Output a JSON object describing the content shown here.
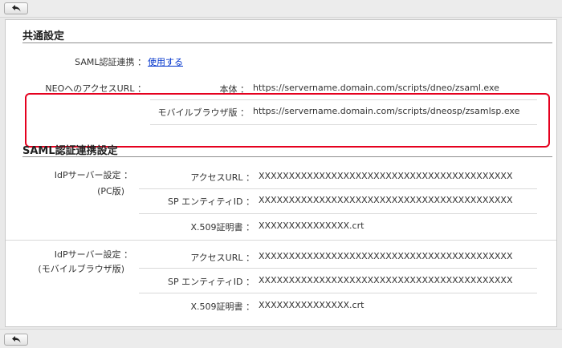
{
  "common": {
    "title": "共通設定",
    "saml_label": "SAML認証連携 ：",
    "saml_value": "使用する",
    "neo_label": "NEOへのアクセスURL ：",
    "main_label": "本体 ：",
    "main_url": "https://servername.domain.com/scripts/dneo/zsaml.exe",
    "mobile_label": "モバイルブラウザ版 ：",
    "mobile_url": "https://servername.domain.com/scripts/dneosp/zsamlsp.exe"
  },
  "saml": {
    "title": "SAML認証連携設定",
    "pc": {
      "label1": "IdPサーバー設定 ：",
      "label2": "(PC版)",
      "access_label": "アクセスURL ：",
      "access_value": "XXXXXXXXXXXXXXXXXXXXXXXXXXXXXXXXXXXXXXXXXX",
      "entity_label": "SP エンティティID ：",
      "entity_value": "XXXXXXXXXXXXXXXXXXXXXXXXXXXXXXXXXXXXXXXXXX",
      "cert_label": "X.509証明書 ：",
      "cert_value": "XXXXXXXXXXXXXXX.crt"
    },
    "mobile": {
      "label1": "IdPサーバー設定 ：",
      "label2": "(モバイルブラウザ版)",
      "access_label": "アクセスURL ：",
      "access_value": "XXXXXXXXXXXXXXXXXXXXXXXXXXXXXXXXXXXXXXXXXX",
      "entity_label": "SP エンティティID ：",
      "entity_value": "XXXXXXXXXXXXXXXXXXXXXXXXXXXXXXXXXXXXXXXXXX",
      "cert_label": "X.509証明書 ：",
      "cert_value": "XXXXXXXXXXXXXXX.crt"
    }
  }
}
